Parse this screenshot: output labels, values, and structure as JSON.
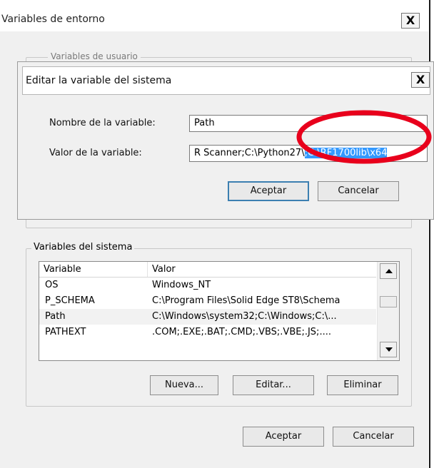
{
  "outer_window": {
    "title": "Variables de entorno",
    "close_label": "X",
    "user_group_legend": "Variables de usuario",
    "ok_label": "Aceptar",
    "cancel_label": "Cancelar"
  },
  "edit_dialog": {
    "title": "Editar la variable del sistema",
    "close_label": "X",
    "name_label": "Nombre de la variable:",
    "name_value": "Path",
    "value_label": "Valor de la variable:",
    "value_text_unselected": "R Scanner;C:\\Python27\\",
    "value_text_selected": ";C:\\RF1700lib\\x64",
    "ok_label": "Aceptar",
    "cancel_label": "Cancelar"
  },
  "system_variables": {
    "legend": "Variables del sistema",
    "columns": [
      "Variable",
      "Valor"
    ],
    "rows": [
      {
        "variable": "OS",
        "value": "Windows_NT"
      },
      {
        "variable": "P_SCHEMA",
        "value": "C:\\Program Files\\Solid Edge ST8\\Schema"
      },
      {
        "variable": "Path",
        "value": "C:\\Windows\\system32;C:\\Windows;C:\\..."
      },
      {
        "variable": "PATHEXT",
        "value": ".COM;.EXE;.BAT;.CMD;.VBS;.VBE;.JS;...."
      }
    ],
    "new_label": "Nueva...",
    "edit_label": "Editar...",
    "delete_label": "Eliminar"
  },
  "colors": {
    "selection": "#3399ff",
    "annotation": "#e8001c",
    "dialog_bg": "#f0f0f0"
  }
}
